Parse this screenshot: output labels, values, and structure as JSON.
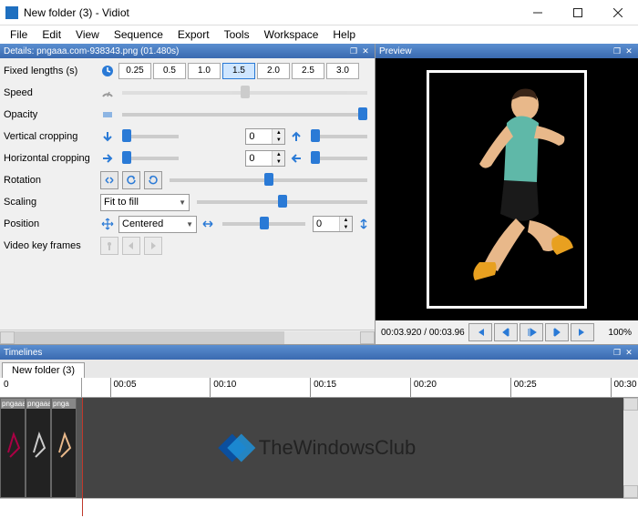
{
  "window": {
    "title": "New folder (3) - Vidiot"
  },
  "menu": [
    "File",
    "Edit",
    "View",
    "Sequence",
    "Export",
    "Tools",
    "Workspace",
    "Help"
  ],
  "details": {
    "header": "Details: pngaaa.com-938343.png (01.480s)",
    "fixed_lengths_label": "Fixed lengths (s)",
    "fixed_lengths": [
      "0.25",
      "0.5",
      "1.0",
      "1.5",
      "2.0",
      "2.5",
      "3.0"
    ],
    "fixed_lengths_selected": "1.5",
    "speed_label": "Speed",
    "opacity_label": "Opacity",
    "vcrop_label": "Vertical cropping",
    "vcrop_value": "0",
    "hcrop_label": "Horizontal cropping",
    "hcrop_value": "0",
    "rotation_label": "Rotation",
    "scaling_label": "Scaling",
    "scaling_value": "Fit to fill",
    "position_label": "Position",
    "position_value": "Centered",
    "position_y": "0",
    "keyframes_label": "Video key frames"
  },
  "preview": {
    "header": "Preview",
    "timecode": "00:03.920 / 00:03.96",
    "zoom": "100%"
  },
  "timelines": {
    "header": "Timelines",
    "tab": "New folder (3)",
    "start": "0",
    "ticks": [
      "00:05",
      "00:10",
      "00:15",
      "00:20",
      "00:25",
      "00:30"
    ],
    "clips": [
      "pngaaa",
      "pngaaa",
      "pnga"
    ]
  },
  "watermark": "TheWindowsClub"
}
